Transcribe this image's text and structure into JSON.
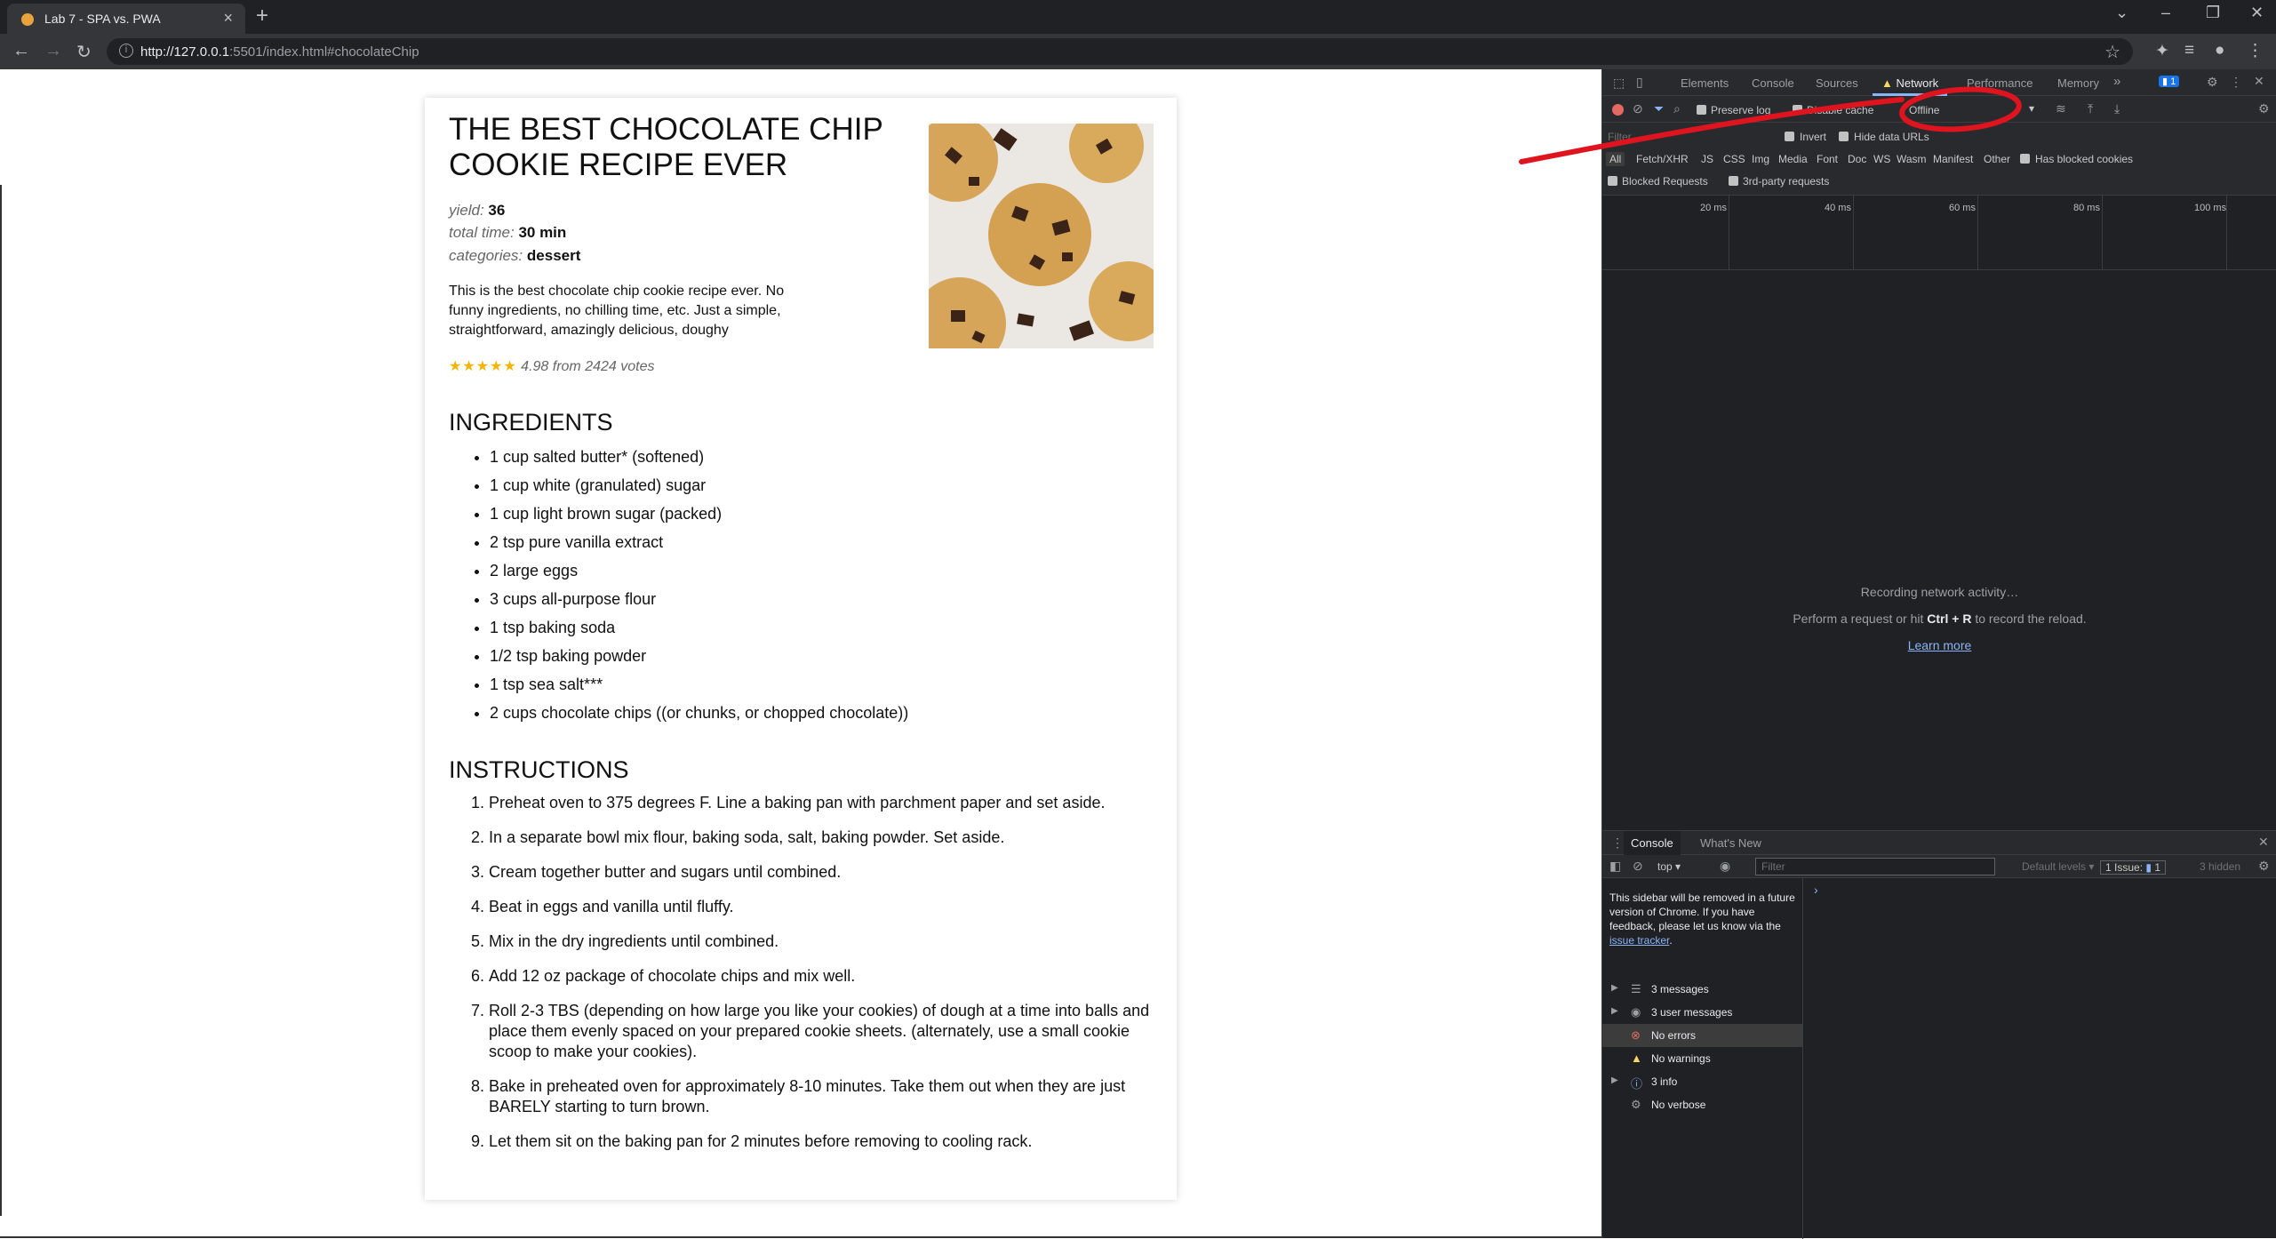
{
  "browser": {
    "tab_title": "Lab 7 - SPA vs. PWA",
    "url_host": "http://127.0.0.1",
    "url_rest": ":5501/index.html#chocolateChip"
  },
  "recipe": {
    "title": "THE BEST CHOCOLATE CHIP COOKIE RECIPE EVER",
    "yield_label": "yield:",
    "yield_value": "36",
    "time_label": "total time:",
    "time_value": "30 min",
    "categories_label": "categories:",
    "categories_value": "dessert",
    "description": "This is the best chocolate chip cookie recipe ever. No funny ingredients, no chilling time, etc. Just a simple, straightforward, amazingly delicious, doughy",
    "stars": "★★★★★",
    "rating_text": "4.98 from 2424 votes",
    "ingredients_title": "INGREDIENTS",
    "ingredients": [
      "1 cup salted butter* (softened)",
      "1 cup white (granulated) sugar",
      "1 cup light brown sugar (packed)",
      "2 tsp pure vanilla extract",
      "2 large eggs",
      "3 cups all-purpose flour",
      "1 tsp baking soda",
      "1/2 tsp baking powder",
      "1 tsp sea salt***",
      "2 cups chocolate chips ((or chunks, or chopped chocolate))"
    ],
    "instructions_title": "INSTRUCTIONS",
    "instructions": [
      "Preheat oven to 375 degrees F. Line a baking pan with parchment paper and set aside.",
      "In a separate bowl mix flour, baking soda, salt, baking powder. Set aside.",
      "Cream together butter and sugars until combined.",
      "Beat in eggs and vanilla until fluffy.",
      "Mix in the dry ingredients until combined.",
      "Add 12 oz package of chocolate chips and mix well.",
      "Roll 2-3 TBS (depending on how large you like your cookies) of dough at a time into balls and place them evenly spaced on your prepared cookie sheets. (alternately, use a small cookie scoop to make your cookies).",
      "Bake in preheated oven for approximately 8-10 minutes. Take them out when they are just BARELY starting to turn brown.",
      "Let them sit on the baking pan for 2 minutes before removing to cooling rack."
    ]
  },
  "devtools": {
    "tabs": [
      "Elements",
      "Console",
      "Sources",
      "Network",
      "Performance",
      "Memory"
    ],
    "more": "»",
    "issues_badge": "1",
    "preserve_log": "Preserve log",
    "disable_cache": "Disable cache",
    "throttle": "Offline",
    "filter_placeholder": "Filter",
    "invert": "Invert",
    "hide_data_urls": "Hide data URLs",
    "type_filters": [
      "All",
      "Fetch/XHR",
      "JS",
      "CSS",
      "Img",
      "Media",
      "Font",
      "Doc",
      "WS",
      "Wasm",
      "Manifest",
      "Other"
    ],
    "has_blocked_cookies": "Has blocked cookies",
    "blocked_requests": "Blocked Requests",
    "third_party": "3rd-party requests",
    "ticks": [
      "20 ms",
      "40 ms",
      "60 ms",
      "80 ms",
      "100 ms"
    ],
    "recording": "Recording network activity…",
    "perform_pre": "Perform a request or hit ",
    "perform_key": "Ctrl + R",
    "perform_post": " to record the reload.",
    "learn_more": "Learn more",
    "drawer_tabs": [
      "Console",
      "What's New"
    ],
    "context": "top",
    "console_filter": "Filter",
    "levels": "Default levels",
    "issue_label": "1 Issue:",
    "issue_count": "1",
    "hidden": "3 hidden",
    "sidebar_note_pre": "This sidebar will be removed in a future version of Chrome. If you have feedback, please let us know via the ",
    "sidebar_note_link": "issue tracker",
    "sidebar_note_post": ".",
    "sidebar_items": [
      {
        "label": "3 messages",
        "icon": "list-icon"
      },
      {
        "label": "3 user messages",
        "icon": "user-icon"
      },
      {
        "label": "No errors",
        "icon": "error-icon"
      },
      {
        "label": "No warnings",
        "icon": "warning-icon"
      },
      {
        "label": "3 info",
        "icon": "info-icon"
      },
      {
        "label": "No verbose",
        "icon": "verbose-icon"
      }
    ]
  },
  "colors": {
    "annotation": "#e0141e",
    "accent": "#8ab4f8",
    "stars": "#f4b400"
  }
}
